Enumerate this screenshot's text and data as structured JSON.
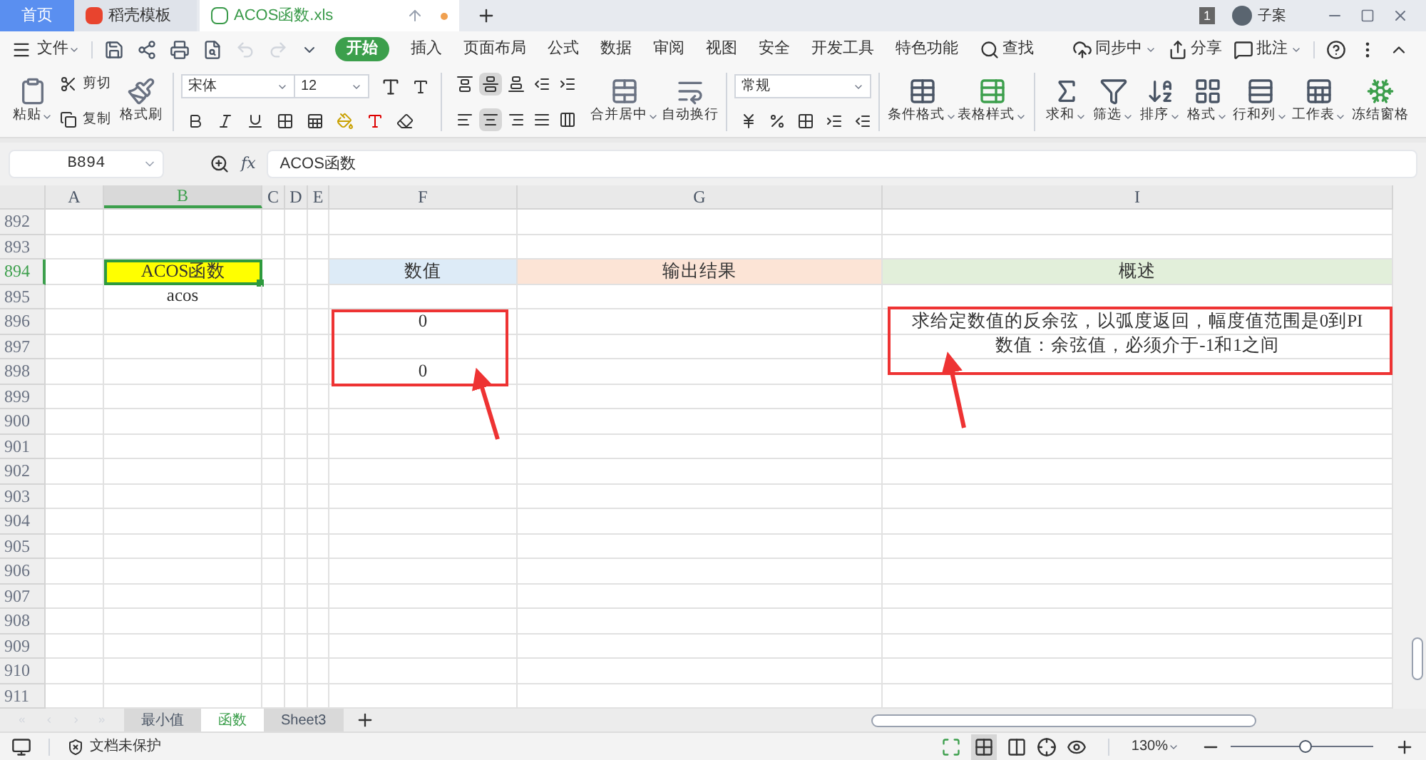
{
  "doc_tabs": [
    {
      "label": "首页",
      "kind": "home",
      "selected": false
    },
    {
      "label": "稻壳模板",
      "kind": "docer",
      "selected": false
    },
    {
      "label": "ACOS函数.xls",
      "kind": "sheet",
      "selected": true
    }
  ],
  "title_bar": {
    "badge": "1",
    "user": "子案"
  },
  "menu": {
    "file": "文件",
    "tabs": [
      {
        "label": "开始",
        "selected": true
      },
      {
        "label": "插入",
        "selected": false
      },
      {
        "label": "页面布局",
        "selected": false
      },
      {
        "label": "公式",
        "selected": false
      },
      {
        "label": "数据",
        "selected": false
      },
      {
        "label": "审阅",
        "selected": false
      },
      {
        "label": "视图",
        "selected": false
      },
      {
        "label": "安全",
        "selected": false
      },
      {
        "label": "开发工具",
        "selected": false
      },
      {
        "label": "特色功能",
        "selected": false
      }
    ],
    "search": "查找",
    "right": [
      "同步中",
      "分享",
      "批注"
    ]
  },
  "toolbar": {
    "paste": "粘贴",
    "cut": "剪切",
    "copy": "复制",
    "format_painter": "格式刷",
    "font": "宋体",
    "font_size": "12",
    "align_top": [
      {
        "selected": false
      },
      {
        "selected": true
      },
      {
        "selected": false
      },
      {
        "selected": false
      },
      {
        "selected": false
      }
    ],
    "align_bottom": [
      {
        "selected": false
      },
      {
        "selected": true
      },
      {
        "selected": false
      },
      {
        "selected": false
      },
      {
        "selected": false
      }
    ],
    "merge": "合并居中",
    "wrap": "自动换行",
    "number_format": "常规",
    "groups": [
      "条件格式",
      "表格样式",
      "求和",
      "筛选",
      "排序",
      "格式",
      "行和列",
      "工作表",
      "冻结窗格"
    ]
  },
  "formula_bar": {
    "cell_ref": "B894",
    "fx": "fx",
    "formula": "ACOS函数"
  },
  "columns": [
    {
      "label": "A",
      "selected": false
    },
    {
      "label": "B",
      "selected": true
    },
    {
      "label": "C",
      "selected": false
    },
    {
      "label": "D",
      "selected": false
    },
    {
      "label": "E",
      "selected": false
    },
    {
      "label": "F",
      "selected": false
    },
    {
      "label": "G",
      "selected": false
    },
    {
      "label": "I",
      "selected": false
    }
  ],
  "rows": [
    {
      "number": "892",
      "selected": false,
      "cells": {}
    },
    {
      "number": "893",
      "selected": false,
      "cells": {}
    },
    {
      "number": "894",
      "selected": true,
      "cells": {
        "B": {
          "text": "ACOS函数",
          "color": "#ffff00",
          "selected": true
        },
        "F": {
          "text": "数值",
          "color": "#ddebf7",
          "selected": false
        },
        "G": {
          "text": "输出结果",
          "color": "#fce4d6",
          "selected": false
        },
        "I": {
          "text": "概述",
          "color": "#e2efda",
          "selected": false
        }
      }
    },
    {
      "number": "895",
      "selected": false,
      "cells": {
        "B": {
          "text": "acos",
          "selected": false
        }
      }
    },
    {
      "number": "896",
      "selected": false,
      "cells": {
        "F": {
          "text": "0",
          "selected": false
        },
        "I": {
          "text": "求给定数值的反余弦，以弧度返回，幅度值范围是0到PI",
          "selected": false
        }
      }
    },
    {
      "number": "897",
      "selected": false,
      "cells": {
        "I": {
          "text": "数值：余弦值，必须介于-1和1之间",
          "selected": false
        }
      }
    },
    {
      "number": "898",
      "selected": false,
      "cells": {
        "F": {
          "text": "0",
          "selected": false
        }
      }
    },
    {
      "number": "899",
      "selected": false,
      "cells": {}
    },
    {
      "number": "900",
      "selected": false,
      "cells": {}
    },
    {
      "number": "901",
      "selected": false,
      "cells": {}
    },
    {
      "number": "902",
      "selected": false,
      "cells": {}
    },
    {
      "number": "903",
      "selected": false,
      "cells": {}
    },
    {
      "number": "904",
      "selected": false,
      "cells": {}
    },
    {
      "number": "905",
      "selected": false,
      "cells": {}
    },
    {
      "number": "906",
      "selected": false,
      "cells": {}
    },
    {
      "number": "907",
      "selected": false,
      "cells": {}
    },
    {
      "number": "908",
      "selected": false,
      "cells": {}
    },
    {
      "number": "909",
      "selected": false,
      "cells": {}
    },
    {
      "number": "910",
      "selected": false,
      "cells": {}
    },
    {
      "number": "911",
      "selected": false,
      "cells": {}
    }
  ],
  "sheet_tabs": [
    {
      "label": "最小值",
      "selected": false
    },
    {
      "label": "函数",
      "selected": true
    },
    {
      "label": "Sheet3",
      "selected": false
    }
  ],
  "status_bar": {
    "protection": "文档未保护",
    "zoom": "130%",
    "zoom_slider": {
      "level": 0.52
    }
  }
}
